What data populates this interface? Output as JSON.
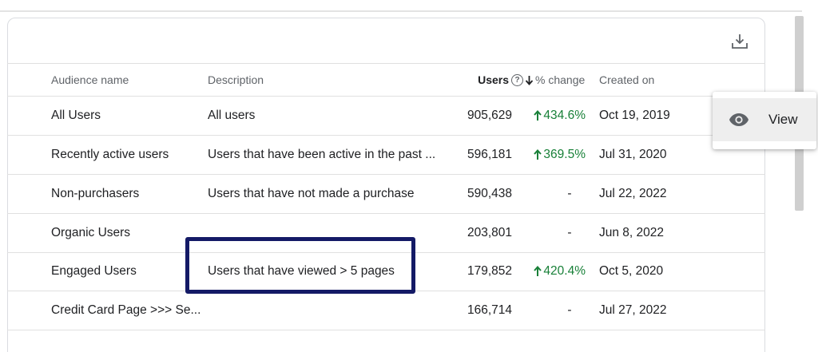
{
  "table": {
    "headers": {
      "name": "Audience name",
      "description": "Description",
      "users": "Users",
      "change": "% change",
      "created": "Created on"
    },
    "rows": [
      {
        "name": "All Users",
        "description": "All users",
        "users": "905,629",
        "change": "434.6%",
        "trend": "up",
        "created": "Oct 19, 2019"
      },
      {
        "name": "Recently active users",
        "description": "Users that have been active in the past ...",
        "users": "596,181",
        "change": "369.5%",
        "trend": "up",
        "created": "Jul 31, 2020"
      },
      {
        "name": "Non-purchasers",
        "description": "Users that have not made a purchase",
        "users": "590,438",
        "change": "-",
        "trend": "none",
        "created": "Jul 22, 2022"
      },
      {
        "name": "Organic Users",
        "description": "",
        "users": "203,801",
        "change": "-",
        "trend": "none",
        "created": "Jun 8, 2022"
      },
      {
        "name": "Engaged Users",
        "description": "Users that have viewed > 5 pages",
        "users": "179,852",
        "change": "420.4%",
        "trend": "up",
        "created": "Oct 5, 2020"
      },
      {
        "name": "Credit Card Page >>> Se...",
        "description": "",
        "users": "166,714",
        "change": "-",
        "trend": "none",
        "created": "Jul 27, 2022"
      }
    ]
  },
  "menu": {
    "view_label": "View"
  },
  "colors": {
    "positive": "#188038",
    "highlight_border": "#141a66"
  },
  "icons": {
    "download": "download-icon",
    "help": "help-circle-icon",
    "sort": "arrow-down-icon",
    "trend_up": "arrow-up-icon",
    "view": "eye-icon"
  }
}
